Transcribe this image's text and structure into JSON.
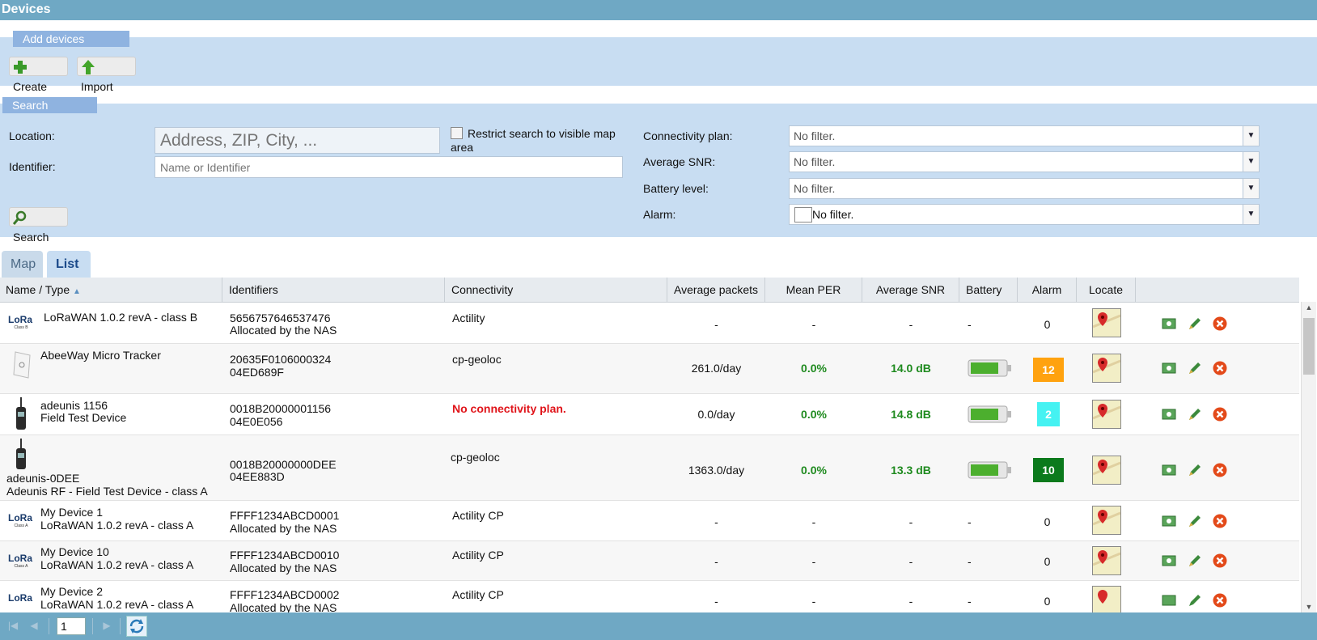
{
  "app": {
    "title": "Devices"
  },
  "add_devices": {
    "legend": "Add devices",
    "create_label": "Create",
    "import_label": "Import"
  },
  "search": {
    "legend": "Search",
    "location_label": "Location:",
    "location_placeholder": "Address, ZIP, City, ...",
    "restrict_label": "Restrict search to visible map area",
    "identifier_label": "Identifier:",
    "identifier_placeholder": "Name or Identifier",
    "search_button": "Search",
    "connectivity_label": "Connectivity plan:",
    "connectivity_value": "No filter.",
    "snr_label": "Average SNR:",
    "snr_value": "No filter.",
    "battery_label": "Battery level:",
    "battery_value": "No filter.",
    "alarm_label": "Alarm:",
    "alarm_value": "No filter."
  },
  "tabs": {
    "map": "Map",
    "list": "List"
  },
  "columns": {
    "name_type": "Name / Type",
    "identifiers": "Identifiers",
    "connectivity": "Connectivity",
    "avg_packets": "Average packets",
    "mean_per": "Mean PER",
    "avg_snr": "Average SNR",
    "battery": "Battery",
    "alarm": "Alarm",
    "locate": "Locate"
  },
  "rows": [
    {
      "name": "LoRaWAN 1.0.2 revA - class B",
      "type": "",
      "id1": "5656757646537476",
      "id2": "Allocated by the NAS",
      "conn": "Actility",
      "packets": "-",
      "per": "-",
      "snr": "-",
      "battery": "-",
      "alarm": "0"
    },
    {
      "name": "AbeeWay Micro Tracker",
      "type": "",
      "id1": "20635F0106000324",
      "id2": "04ED689F",
      "conn": "cp-geoloc",
      "packets": "261.0/day",
      "per": "0.0%",
      "snr": "14.0 dB",
      "battery": "",
      "alarm": "12"
    },
    {
      "name": "adeunis 1156",
      "type": "Field Test Device",
      "id1": "0018B20000001156",
      "id2": "04E0E056",
      "conn": "No connectivity plan.",
      "packets": "0.0/day",
      "per": "0.0%",
      "snr": "14.8 dB",
      "battery": "",
      "alarm": "2"
    },
    {
      "name": "adeunis-0DEE",
      "type": "Adeunis RF - Field Test Device - class A",
      "id1": "0018B20000000DEE",
      "id2": "04EE883D",
      "conn": "cp-geoloc",
      "packets": "1363.0/day",
      "per": "0.0%",
      "snr": "13.3 dB",
      "battery": "",
      "alarm": "10"
    },
    {
      "name": "My Device 1",
      "type": "LoRaWAN 1.0.2 revA - class A",
      "id1": "FFFF1234ABCD0001",
      "id2": "Allocated by the NAS",
      "conn": "Actility CP",
      "packets": "-",
      "per": "-",
      "snr": "-",
      "battery": "-",
      "alarm": "0"
    },
    {
      "name": "My Device 10",
      "type": "LoRaWAN 1.0.2 revA - class A",
      "id1": "FFFF1234ABCD0010",
      "id2": "Allocated by the NAS",
      "conn": "Actility CP",
      "packets": "-",
      "per": "-",
      "snr": "-",
      "battery": "-",
      "alarm": "0"
    },
    {
      "name": "My Device 2",
      "type": "LoRaWAN 1.0.2 revA - class A",
      "id1": "FFFF1234ABCD0002",
      "id2": "Allocated by the NAS",
      "conn": "Actility CP",
      "packets": "-",
      "per": "-",
      "snr": "-",
      "battery": "-",
      "alarm": "0"
    }
  ],
  "icons": {
    "lora_logo": "LoRa",
    "lora_class_b": "Class B",
    "lora_class_a": "Class A"
  },
  "colors": {
    "alarm_orange": "#ffa20f",
    "alarm_cyan": "#45f2f2",
    "alarm_green": "#0b7a1c",
    "titlebar": "#6fa8c4"
  },
  "pagination": {
    "page": "1"
  }
}
